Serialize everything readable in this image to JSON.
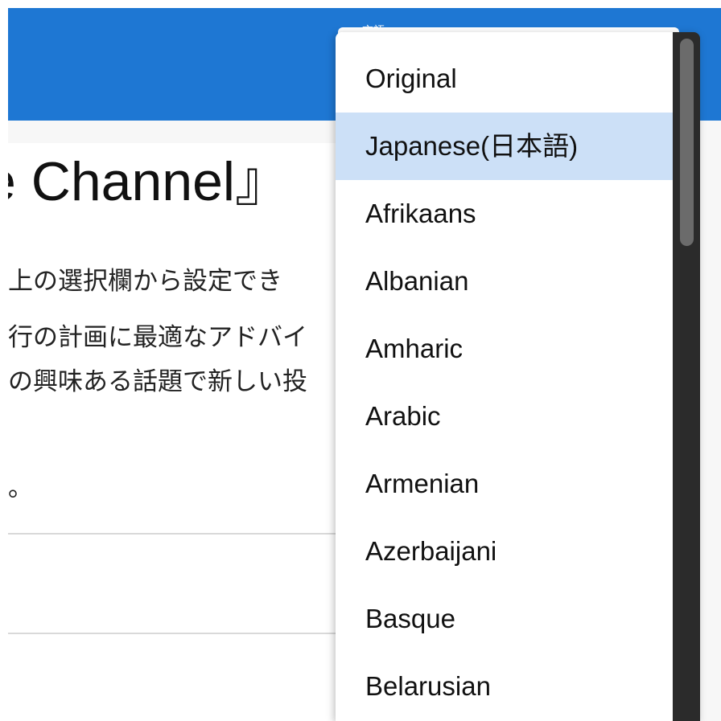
{
  "header": {
    "translate_label": "言語"
  },
  "main": {
    "title": "e Channel』",
    "paragraphs": [
      "上の選択欄から設定でき",
      "行の計画に最適なアドバイ",
      "の興味ある話題で新しい投",
      "。"
    ]
  },
  "language_dropdown": {
    "selected": "Japanese(日本語)",
    "options": [
      "Original",
      "Japanese(日本語)",
      "Afrikaans",
      "Albanian",
      "Amharic",
      "Arabic",
      "Armenian",
      "Azerbaijani",
      "Basque",
      "Belarusian"
    ]
  },
  "colors": {
    "header_bg": "#1e77d3",
    "selected_option_bg": "#cce0f7",
    "scrollbar_track": "#2b2b2b",
    "scrollbar_thumb": "#6b6b6b"
  }
}
